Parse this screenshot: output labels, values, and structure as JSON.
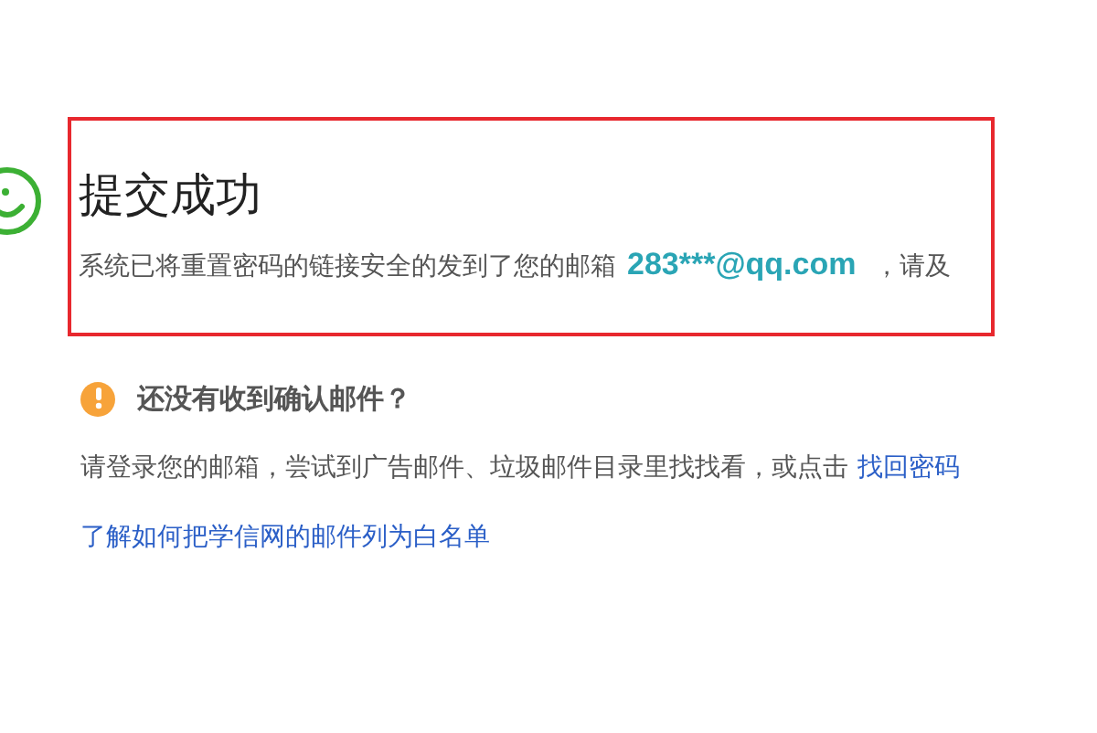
{
  "success": {
    "title": "提交成功",
    "message": "系统已将重置密码的链接安全的发到了您的邮箱",
    "email": "283***@qq.com",
    "message_tail": "，请及"
  },
  "help": {
    "heading": "还没有收到确认邮件？",
    "body": "请登录您的邮箱，尝试到广告邮件、垃圾邮件目录里找找看，或点击",
    "link": "找回密码",
    "whitelist_link": "了解如何把学信网的邮件列为白名单"
  }
}
